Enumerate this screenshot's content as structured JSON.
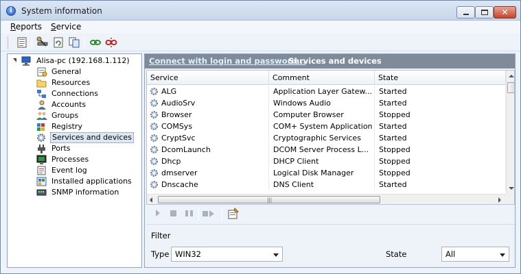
{
  "window": {
    "title": "System information"
  },
  "menu": {
    "reports": "Reports",
    "service": "Service"
  },
  "tree": {
    "root": "Alisa-pc (192.168.1.112)",
    "items": [
      {
        "label": "General",
        "icon": "general-icon"
      },
      {
        "label": "Resources",
        "icon": "folder-icon"
      },
      {
        "label": "Connections",
        "icon": "connections-icon"
      },
      {
        "label": "Accounts",
        "icon": "user-icon"
      },
      {
        "label": "Groups",
        "icon": "users-group-icon"
      },
      {
        "label": "Registry",
        "icon": "registry-icon"
      },
      {
        "label": "Services and devices",
        "icon": "gear-icon",
        "selected": true
      },
      {
        "label": "Ports",
        "icon": "plug-icon"
      },
      {
        "label": "Processes",
        "icon": "process-icon"
      },
      {
        "label": "Event log",
        "icon": "event-log-icon"
      },
      {
        "label": "Installed applications",
        "icon": "installed-apps-icon"
      },
      {
        "label": "SNMP information",
        "icon": "snmp-icon"
      }
    ]
  },
  "panel": {
    "connect_link": "Connect with login and password...",
    "title": "Services and devices"
  },
  "grid": {
    "columns": [
      "Service",
      "Comment",
      "State"
    ],
    "rows": [
      [
        "ALG",
        "Application Layer Gatew...",
        "Started"
      ],
      [
        "AudioSrv",
        "Windows Audio",
        "Started"
      ],
      [
        "Browser",
        "Computer Browser",
        "Stopped"
      ],
      [
        "COMSys",
        "COM+ System Application",
        "Started"
      ],
      [
        "CryptSvc",
        "Cryptographic Services",
        "Started"
      ],
      [
        "DcomLaunch",
        "DCOM Server Process L...",
        "Stopped"
      ],
      [
        "Dhcp",
        "DHCP Client",
        "Stopped"
      ],
      [
        "dmserver",
        "Logical Disk Manager",
        "Stopped"
      ],
      [
        "Dnscache",
        "DNS Client",
        "Started"
      ]
    ]
  },
  "filter": {
    "title": "Filter",
    "type_label": "Type",
    "type_value": "WIN32",
    "state_label": "State",
    "state_value": "All"
  }
}
